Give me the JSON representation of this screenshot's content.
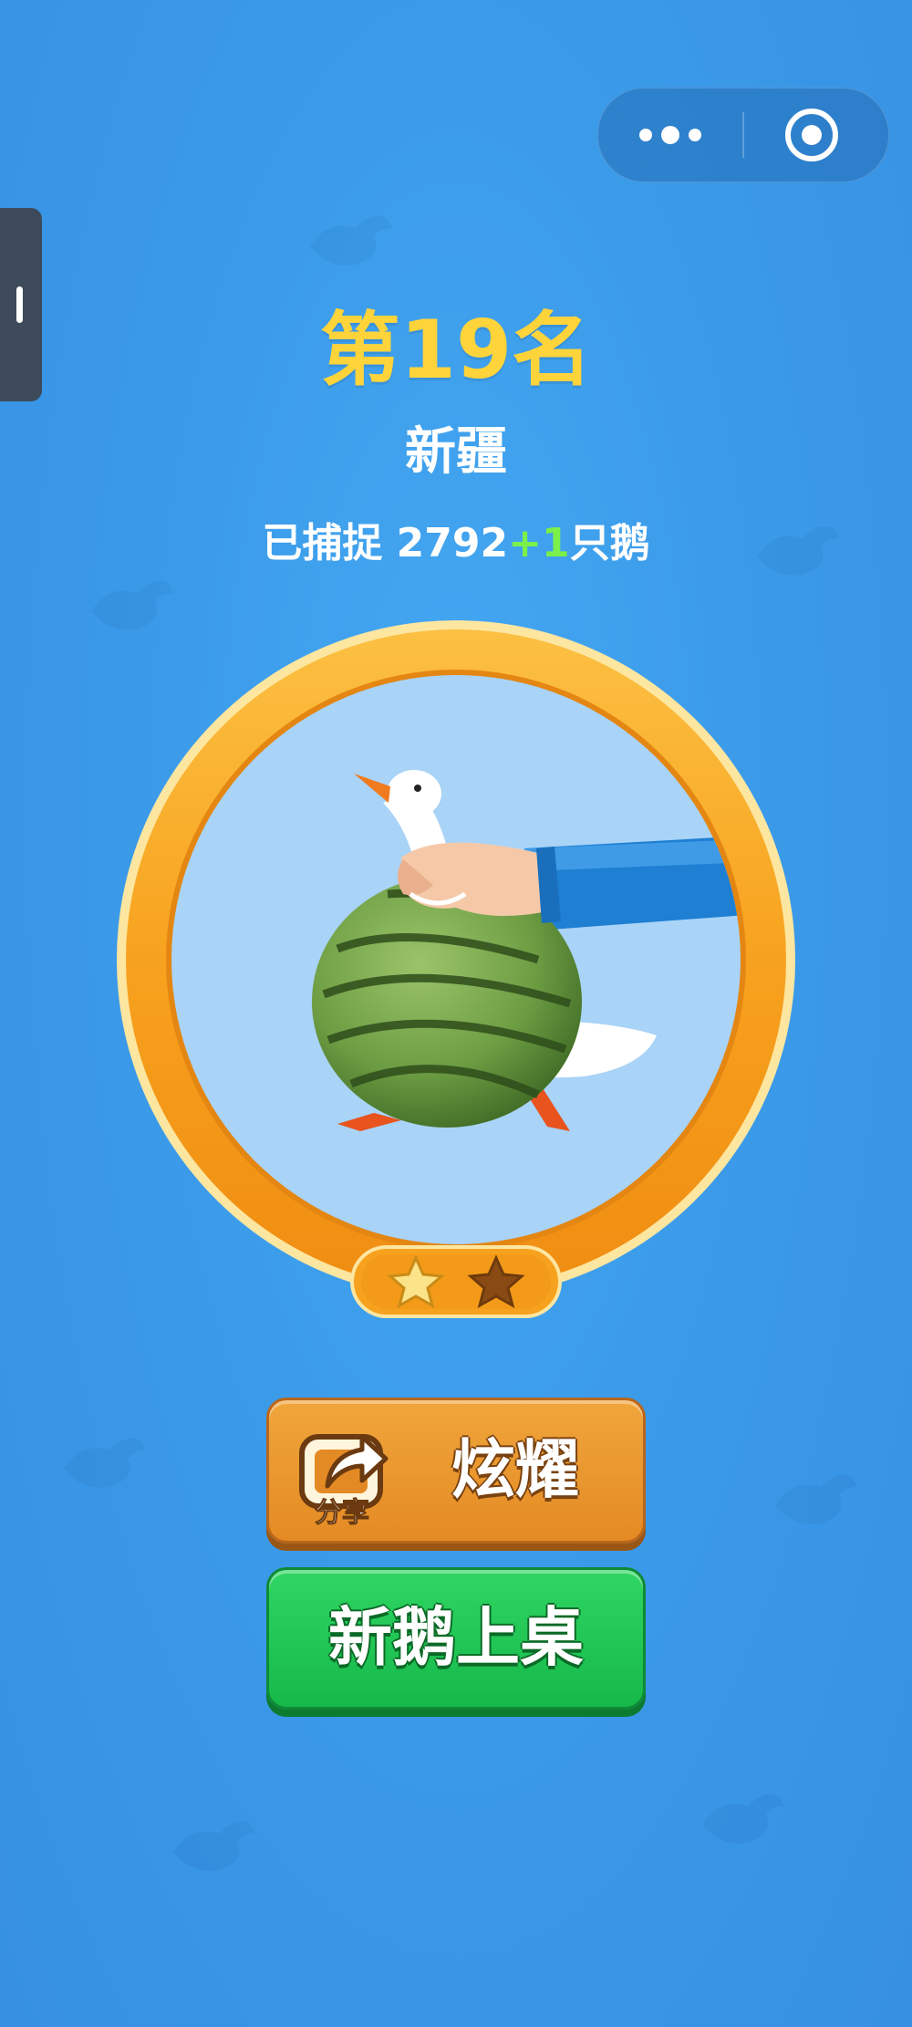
{
  "colors": {
    "background": "#3b9be9",
    "rank_text": "#ffd43a",
    "plus_text": "#7bf04a",
    "ring": "#f7a21e",
    "share_button": "#e48a24",
    "new_button": "#16b84a"
  },
  "capsule": {
    "menu_icon": "more-dots-icon",
    "close_icon": "target-circle-icon"
  },
  "result": {
    "rank": "第19名",
    "region": "新疆",
    "caught_prefix": "已捕捉 2792",
    "caught_plus": "+1",
    "caught_suffix": "只鹅"
  },
  "portrait": {
    "icon": "goose-watermelon-image",
    "stars_earned": 1,
    "stars_total": 2
  },
  "buttons": {
    "share_caption": "分享",
    "share_label": "炫耀",
    "share_icon": "share-arrow-icon",
    "new_goose_label": "新鹅上桌"
  }
}
